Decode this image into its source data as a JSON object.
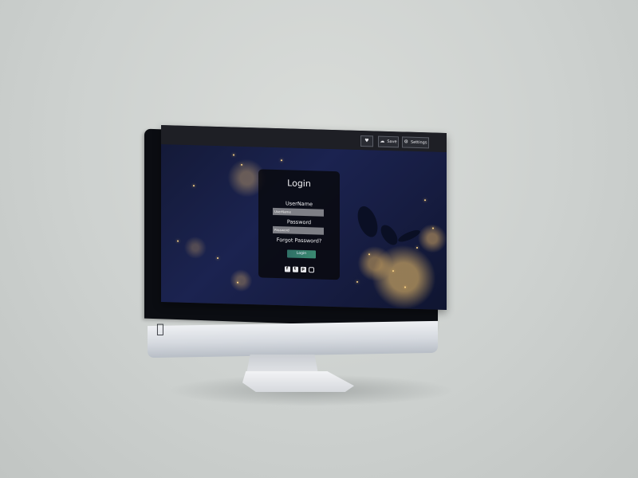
{
  "toolbar": {
    "heart_icon": "heart-icon",
    "save_label": "Save",
    "save_icon": "cloud-icon",
    "settings_label": "Settings",
    "settings_icon": "gear-icon"
  },
  "login": {
    "title": "Login",
    "username_label": "UserName",
    "username_placeholder": "UserName",
    "password_label": "Password",
    "password_placeholder": "Password",
    "forgot_label": "Forgot Password?",
    "button_label": "Login"
  },
  "social": {
    "icons": [
      "facebook-icon",
      "twitter-icon",
      "pinterest-icon",
      "instagram-icon"
    ]
  },
  "colors": {
    "card_bg": "#08080c",
    "input_bg": "#7e7f86",
    "button": "#3b8a72",
    "topbar": "#1e1f25"
  }
}
